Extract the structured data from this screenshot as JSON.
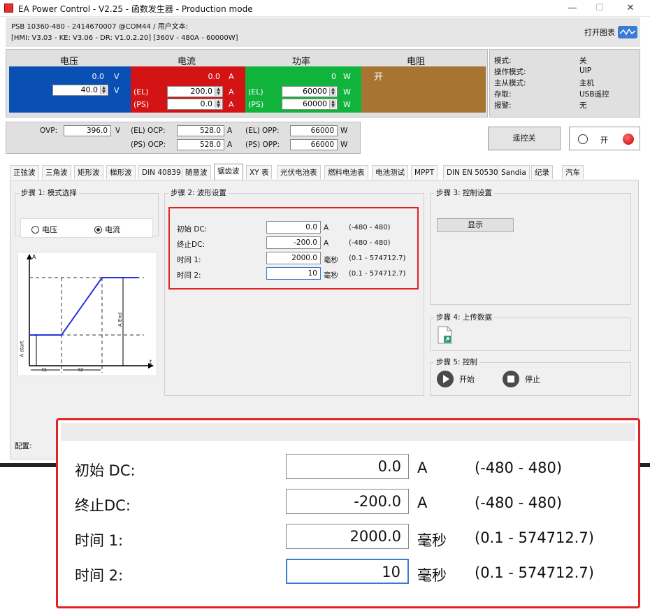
{
  "window": {
    "title": "EA Power Control - V2.25 - 函数发生器 - Production mode",
    "minimize": "—",
    "maximize": "☐",
    "close": "✕"
  },
  "device": {
    "line1": "PSB 10360-480 - 2414670007 @COM44 / 用户文本:",
    "line2": "[HMI: V3.03 - KE: V3.06 - DR: V1.0.2.20] [360V - 480A - 60000W]",
    "chart_button": "打开图表"
  },
  "measure": {
    "voltage_label": "电压",
    "current_label": "电流",
    "power_label": "功率",
    "resistance_label": "电阻",
    "voltage_actual": "0.0",
    "voltage_unit": "V",
    "voltage_set": "40.0",
    "current_actual": "0.0",
    "current_unit": "A",
    "current_el": "200.0",
    "current_ps": "0.0",
    "power_actual": "0",
    "power_unit": "W",
    "power_el": "60000",
    "power_ps": "60000",
    "el_tag": "(EL)",
    "ps_tag": "(PS)",
    "resistance_state": "开"
  },
  "status": {
    "mode_label": "模式:",
    "mode_value": "关",
    "opmode_label": "操作模式:",
    "opmode_value": "UIP",
    "master_label": "主从模式:",
    "master_value": "主机",
    "access_label": "存取:",
    "access_value": "USB遥控",
    "alarm_label": "报警:",
    "alarm_value": "无"
  },
  "protection": {
    "ovp_label": "OVP:",
    "ovp_value": "396.0",
    "ovp_unit": "V",
    "el_ocp_label": "(EL) OCP:",
    "el_ocp_value": "528.0",
    "ps_ocp_label": "(PS) OCP:",
    "ps_ocp_value": "528.0",
    "ocp_unit": "A",
    "el_opp_label": "(EL) OPP:",
    "el_opp_value": "66000",
    "ps_opp_label": "(PS) OPP:",
    "ps_opp_value": "66000",
    "opp_unit": "W"
  },
  "remote": {
    "button": "遥控关",
    "on_label": "开"
  },
  "tabs": [
    "正弦波",
    "三角波",
    "矩形波",
    "梯形波",
    "DIN 40839",
    "随意波",
    "锯齿波",
    "XY 表",
    "光伏电池表",
    "燃料电池表",
    "电池测试",
    "MPPT",
    "DIN EN 50530",
    "Sandia",
    "纪录",
    "汽车"
  ],
  "step1": {
    "title": "步骤 1: 模式选择",
    "opt_voltage": "电压",
    "opt_current": "电流"
  },
  "diagram": {
    "y_axis": "A",
    "x_axis": "t",
    "a_start": "A start",
    "a_end": "A End",
    "t1": "t1",
    "t2": "t2"
  },
  "step2": {
    "title": "步骤 2: 波形设置",
    "rows": [
      {
        "label": "初始 DC:",
        "value": "0.0",
        "unit": "A",
        "range": "(-480 - 480)"
      },
      {
        "label": "终止DC:",
        "value": "-200.0",
        "unit": "A",
        "range": "(-480 - 480)"
      },
      {
        "label": "时间 1:",
        "value": "2000.0",
        "unit": "毫秒",
        "range": "(0.1 - 574712.7)"
      },
      {
        "label": "时间 2:",
        "value": "10",
        "unit": "毫秒",
        "range": "(0.1 - 574712.7)"
      }
    ]
  },
  "step3": {
    "title": "步骤 3: 控制设置",
    "button": "显示"
  },
  "step4": {
    "title": "步骤 4: 上传数据"
  },
  "step5": {
    "title": "步骤 5: 控制",
    "start": "开始",
    "stop": "停止"
  },
  "config_label": "配置:"
}
